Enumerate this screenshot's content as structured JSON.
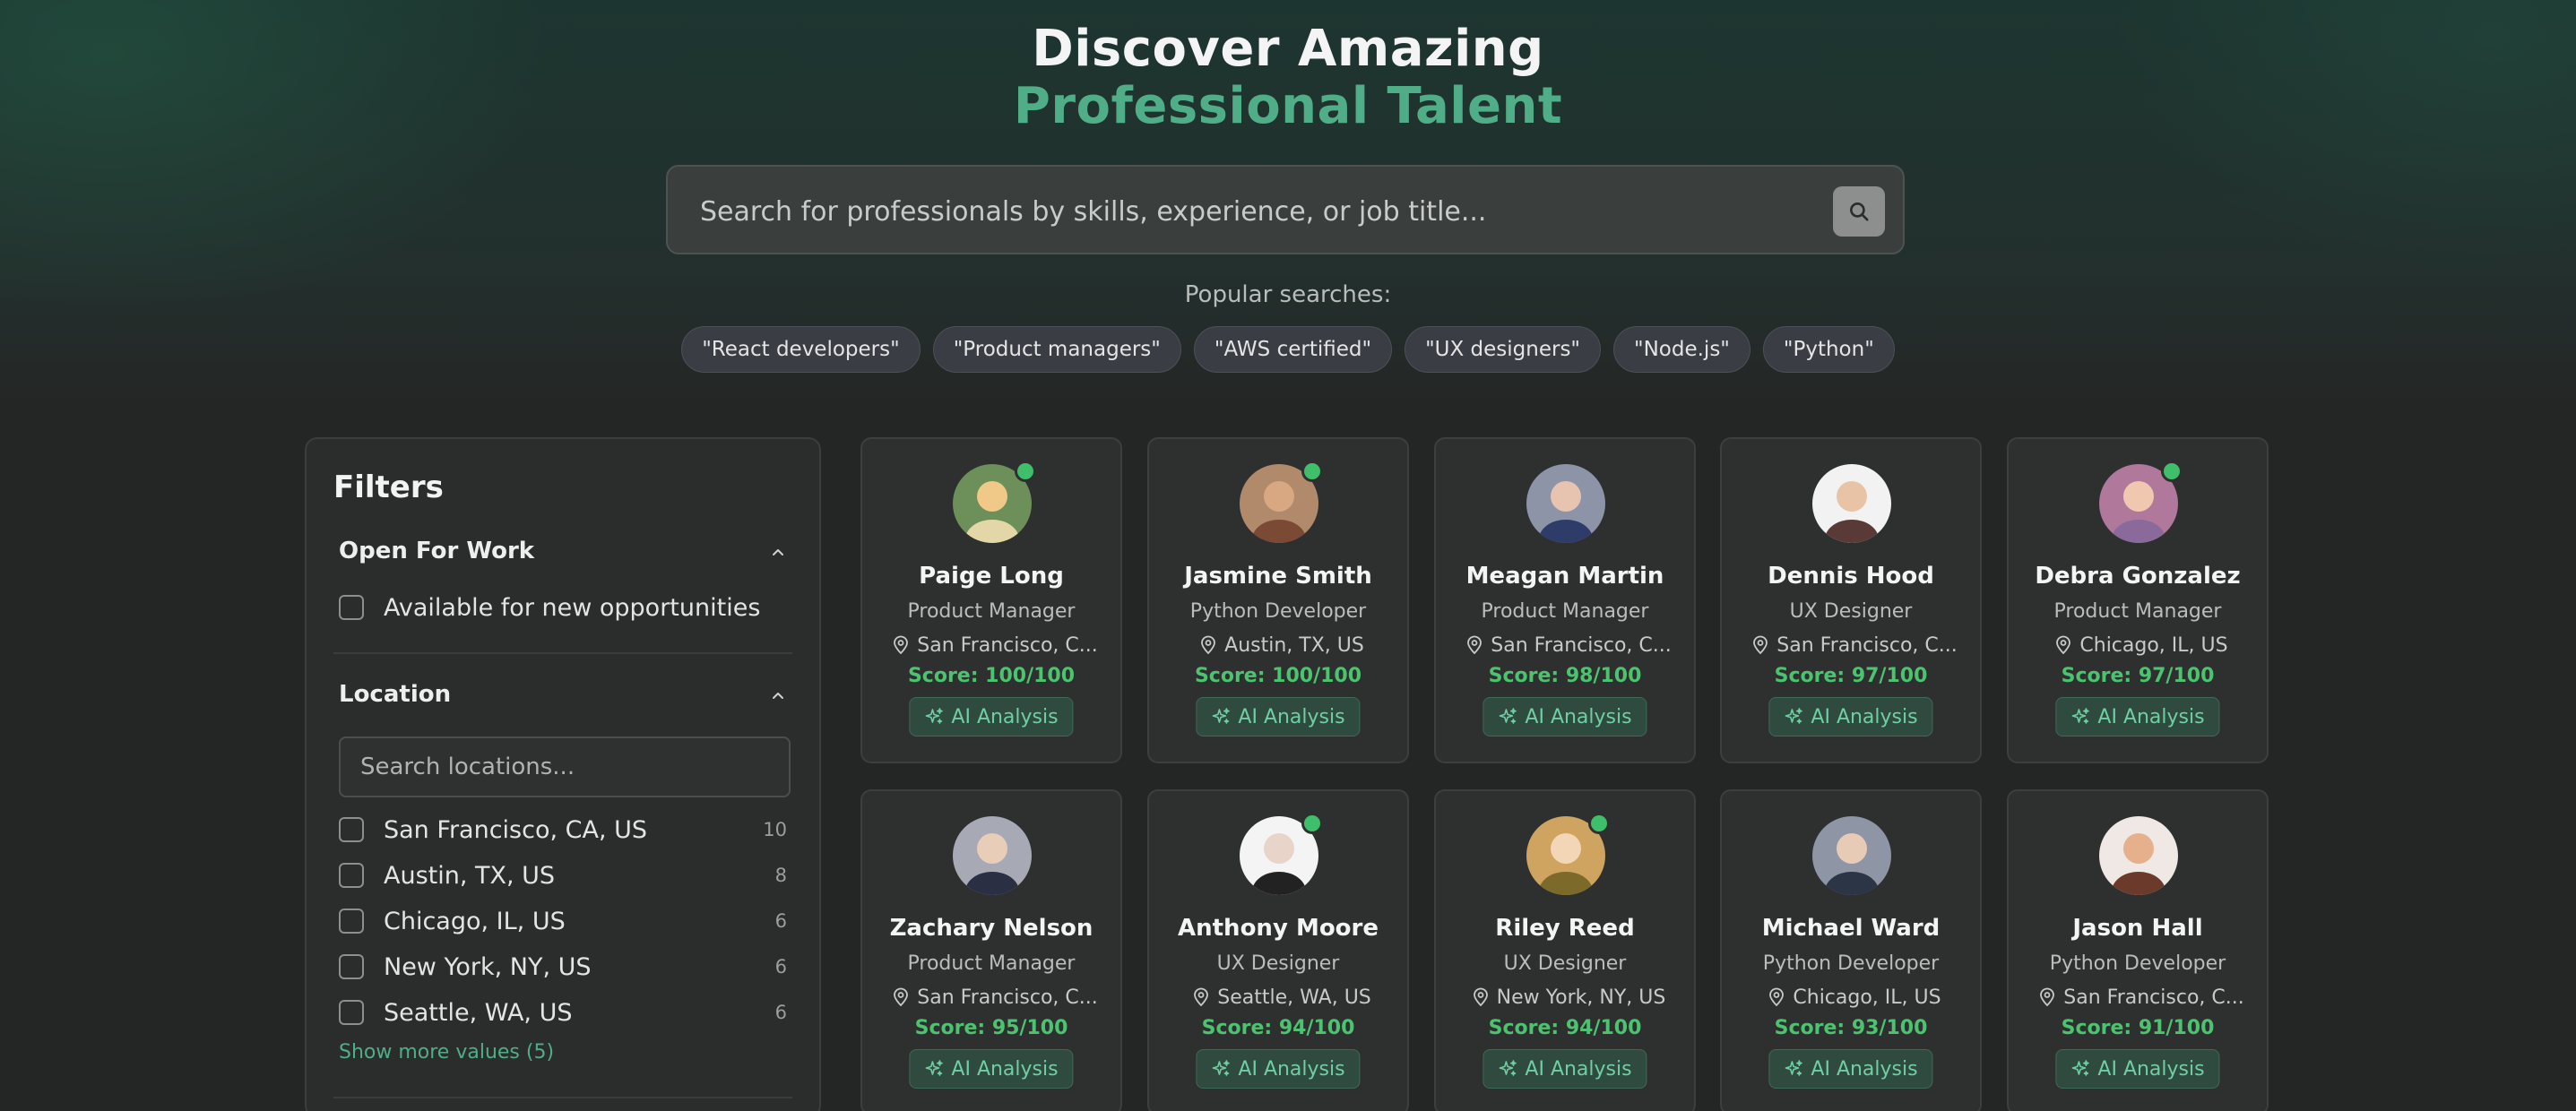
{
  "hero": {
    "title": "Discover Amazing",
    "subtitle": "Professional Talent"
  },
  "search": {
    "placeholder": "Search for professionals by skills, experience, or job title...",
    "button_icon": "search-icon"
  },
  "popular": {
    "label": "Popular searches:",
    "chips": [
      "\"React developers\"",
      "\"Product managers\"",
      "\"AWS certified\"",
      "\"UX designers\"",
      "\"Node.js\"",
      "\"Python\""
    ]
  },
  "filters": {
    "title": "Filters",
    "open_for_work": {
      "title": "Open For Work",
      "option": "Available for new opportunities"
    },
    "location": {
      "title": "Location",
      "search_placeholder": "Search locations...",
      "options": [
        {
          "label": "San Francisco, CA, US",
          "count": "10"
        },
        {
          "label": "Austin, TX, US",
          "count": "8"
        },
        {
          "label": "Chicago, IL, US",
          "count": "6"
        },
        {
          "label": "New York, NY, US",
          "count": "6"
        },
        {
          "label": "Seattle, WA, US",
          "count": "6"
        }
      ],
      "show_more": "Show more values (5)"
    }
  },
  "ai_label": "AI Analysis",
  "colors": {
    "accent": "#4fae87",
    "score": "#4cc36f",
    "online": "#3fbf6a"
  },
  "candidates": [
    {
      "name": "Paige Long",
      "role": "Product Manager",
      "location": "San Francisco, C...",
      "score": "Score: 100/100",
      "online": true
    },
    {
      "name": "Jasmine Smith",
      "role": "Python Developer",
      "location": "Austin, TX, US",
      "score": "Score: 100/100",
      "online": true
    },
    {
      "name": "Meagan Martin",
      "role": "Product Manager",
      "location": "San Francisco, C...",
      "score": "Score: 98/100",
      "online": false
    },
    {
      "name": "Dennis Hood",
      "role": "UX Designer",
      "location": "San Francisco, C...",
      "score": "Score: 97/100",
      "online": false
    },
    {
      "name": "Debra Gonzalez",
      "role": "Product Manager",
      "location": "Chicago, IL, US",
      "score": "Score: 97/100",
      "online": true
    },
    {
      "name": "Zachary Nelson",
      "role": "Product Manager",
      "location": "San Francisco, C...",
      "score": "Score: 95/100",
      "online": false
    },
    {
      "name": "Anthony Moore",
      "role": "UX Designer",
      "location": "Seattle, WA, US",
      "score": "Score: 94/100",
      "online": true
    },
    {
      "name": "Riley Reed",
      "role": "UX Designer",
      "location": "New York, NY, US",
      "score": "Score: 94/100",
      "online": true
    },
    {
      "name": "Michael Ward",
      "role": "Python Developer",
      "location": "Chicago, IL, US",
      "score": "Score: 93/100",
      "online": false
    },
    {
      "name": "Jason Hall",
      "role": "Python Developer",
      "location": "San Francisco, C...",
      "score": "Score: 91/100",
      "online": false
    }
  ]
}
